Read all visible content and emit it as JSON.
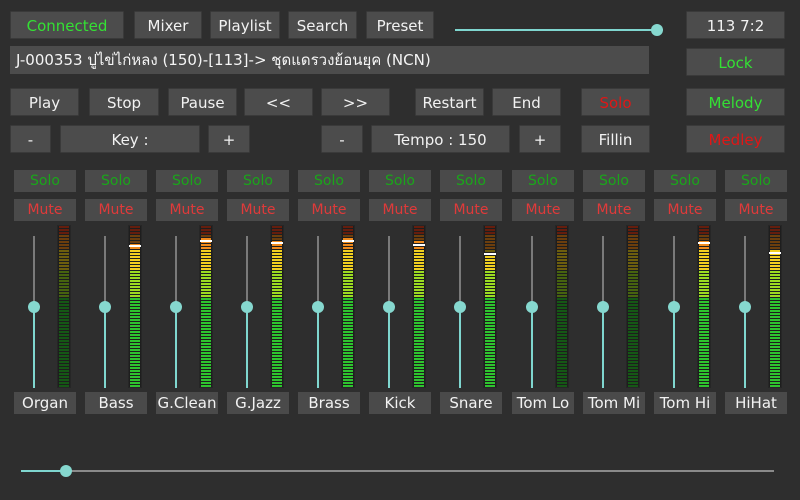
{
  "toolbar": {
    "connected": "Connected",
    "mixer": "Mixer",
    "playlist": "Playlist",
    "search": "Search",
    "preset": "Preset",
    "status": "113  7:2",
    "lock": "Lock"
  },
  "top_slider_level": 0.97,
  "song_title": "J-000353 ปูไข่ไก่หลง (150)-[113]-> ชุดแดรวงย้อนยุค (NCN)",
  "transport": {
    "play": "Play",
    "stop": "Stop",
    "pause": "Pause",
    "prev": "<<",
    "next": ">>",
    "restart": "Restart",
    "end": "End",
    "solo": "Solo",
    "melody": "Melody"
  },
  "controls": {
    "key_minus": "-",
    "key_label": "Key :",
    "key_plus": "+",
    "tempo_minus": "-",
    "tempo_label": "Tempo : 150",
    "tempo_plus": "+",
    "fillin": "Fillin",
    "medley": "Medley"
  },
  "channel_solo_label": "Solo",
  "channel_mute_label": "Mute",
  "channels": [
    {
      "name": "Organ",
      "level": 0.53,
      "meter": 0.0
    },
    {
      "name": "Bass",
      "level": 0.53,
      "meter": 0.88
    },
    {
      "name": "G.Clean",
      "level": 0.53,
      "meter": 0.91
    },
    {
      "name": "G.Jazz",
      "level": 0.53,
      "meter": 0.9
    },
    {
      "name": "Brass",
      "level": 0.53,
      "meter": 0.91
    },
    {
      "name": "Kick",
      "level": 0.53,
      "meter": 0.89
    },
    {
      "name": "Snare",
      "level": 0.53,
      "meter": 0.83
    },
    {
      "name": "Tom Lo",
      "level": 0.53,
      "meter": 0.0
    },
    {
      "name": "Tom Mi",
      "level": 0.53,
      "meter": 0.0
    },
    {
      "name": "Tom Hi",
      "level": 0.53,
      "meter": 0.9
    },
    {
      "name": "HiHat",
      "level": 0.53,
      "meter": 0.84
    }
  ],
  "master_level": 0.06,
  "colors": {
    "background": "#2e2e2e",
    "button": "#4c4c4c",
    "accent_green": "#34e034",
    "accent_red": "#e01616",
    "slider": "#86d8cf"
  }
}
